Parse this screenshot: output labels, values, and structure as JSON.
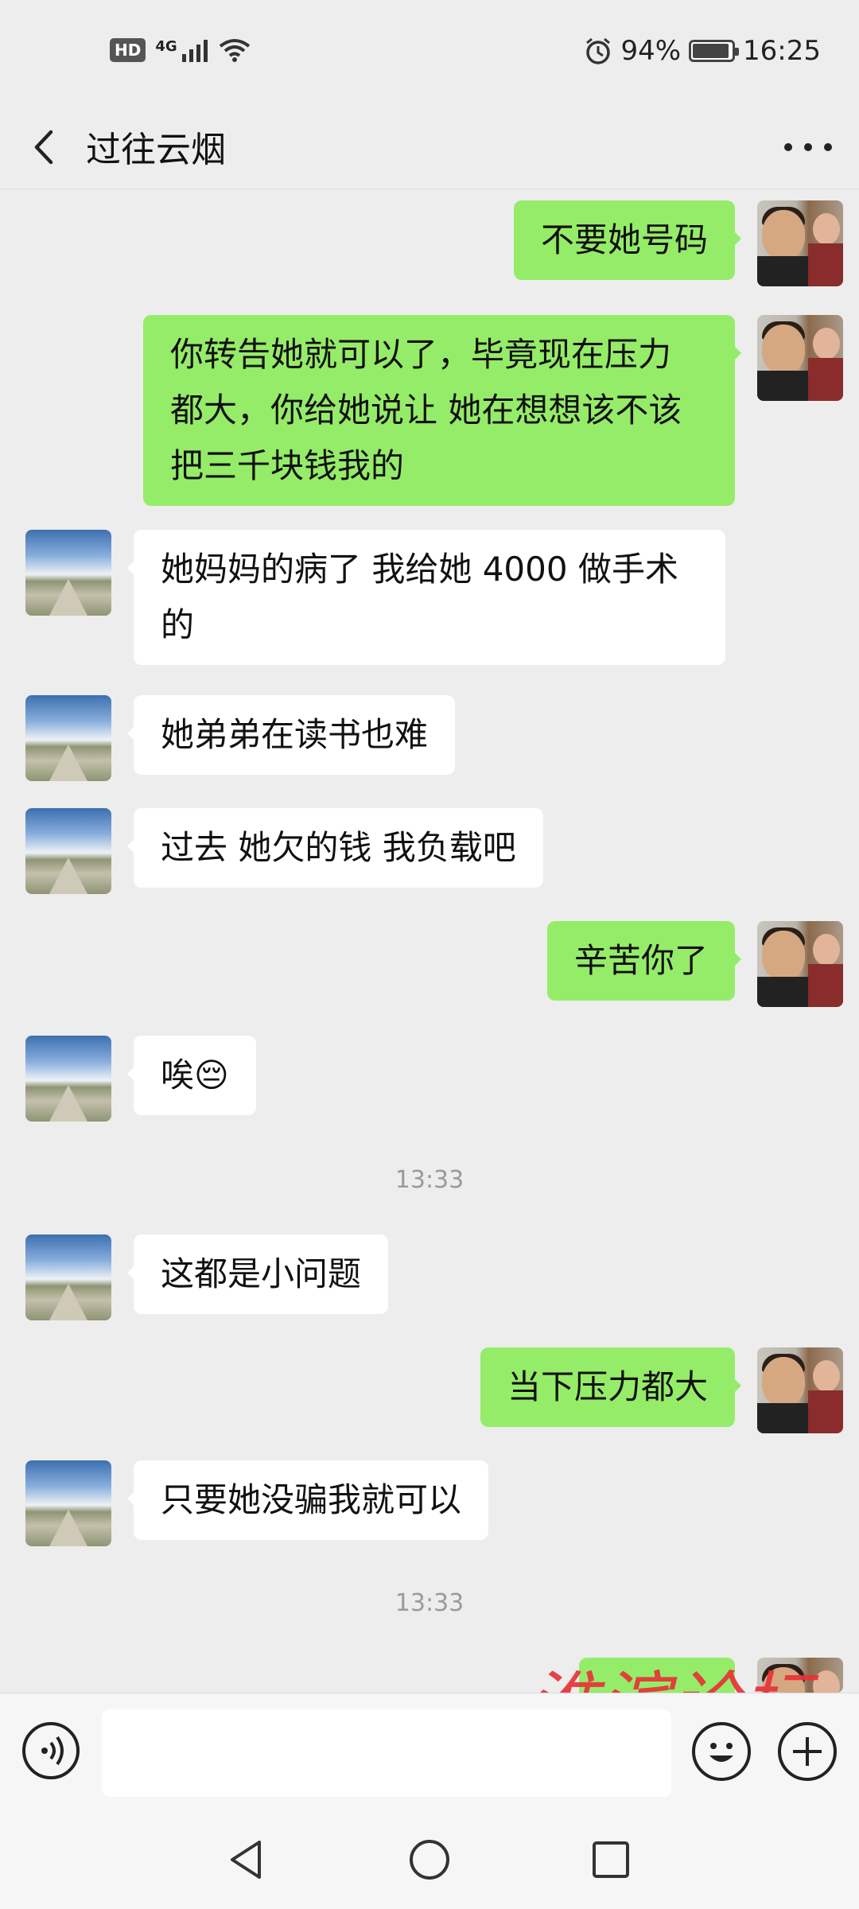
{
  "status_bar": {
    "hd": "HD",
    "network": "4G",
    "battery_pct": "94%",
    "battery_level": 0.94,
    "time": "16:25"
  },
  "header": {
    "title": "过往云烟"
  },
  "messages": [
    {
      "from": "me",
      "text": "不要她号码"
    },
    {
      "from": "me",
      "lines": [
        "你转告她就可以了，毕竟现在压力",
        "都大，你给她说让 她在想想该不该",
        "把三千块钱我的"
      ]
    },
    {
      "from": "other",
      "lines": [
        "她妈妈的病了 我给她 4000 做手术",
        "的"
      ]
    },
    {
      "from": "other",
      "text": "她弟弟在读书也难"
    },
    {
      "from": "other",
      "text": "过去 她欠的钱 我负载吧"
    },
    {
      "from": "me",
      "text": "辛苦你了"
    },
    {
      "from": "other",
      "text": "唉😔"
    },
    {
      "from": "other",
      "text": "这都是小问题"
    },
    {
      "from": "me",
      "text": "当下压力都大"
    },
    {
      "from": "other",
      "text": "只要她没骗我就可以"
    }
  ],
  "timestamps": [
    "13:33",
    "13:33"
  ],
  "watermark": "淮滨论坛",
  "colors": {
    "my_bubble": "#95ec69",
    "other_bubble": "#ffffff",
    "background": "#ededed",
    "watermark": "#e8323a"
  }
}
